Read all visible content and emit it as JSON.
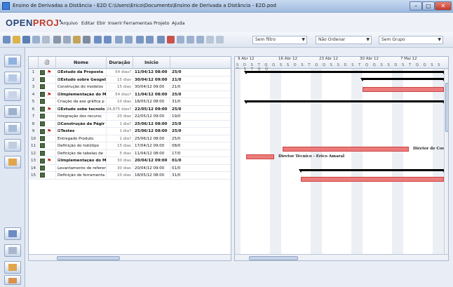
{
  "window": {
    "title": "Ensino de Derivadas a Distância - E2D  C:\\Users\\Erico\\Documents\\Ensino de Derivada a Distância - E2D.pod",
    "min": "–",
    "max": "□",
    "close": "✕"
  },
  "app": {
    "logo_a": "OPEN",
    "logo_b": "PROJ",
    "logo_tm": "'"
  },
  "menu": [
    "Arquivo",
    "Editar",
    "Ebir",
    "Inserir",
    "Ferramentas",
    "Projeto",
    "Ajuda"
  ],
  "toolbar": {
    "filter": "Sem filtro",
    "sort": "Não Ordenar",
    "group": "Sem Grupo"
  },
  "table": {
    "headers": [
      "",
      "",
      "Nome",
      "Duração",
      "Início",
      ""
    ],
    "rows": [
      {
        "num": "1",
        "name": "⊟Estudo da Proposta",
        "dur": "54 dias?",
        "ini": "11/04/12 08:00",
        "fim": "25/0",
        "bold": true,
        "pin": true
      },
      {
        "num": "2",
        "name": "⊟Estudo sobre Geogeb",
        "dur": "15 dias",
        "ini": "30/04/12 09:00",
        "fim": "21/0",
        "bold": true,
        "pin": false
      },
      {
        "num": "3",
        "name": "Construção do modelos",
        "dur": "15 dias",
        "ini": "30/04/12 09:00",
        "fim": "21/0",
        "bold": false,
        "pin": false
      },
      {
        "num": "4",
        "name": "⊟Implementação do Mo",
        "dur": "54 dias?",
        "ini": "11/04/12 08:00",
        "fim": "25/0",
        "bold": true,
        "pin": true
      },
      {
        "num": "5",
        "name": "Criação da ase gráfica p",
        "dur": "10 dias",
        "ini": "18/05/12 08:00",
        "fim": "31/0",
        "bold": false,
        "pin": false
      },
      {
        "num": "6",
        "name": "⊟Estudo sobe tecnolo",
        "dur": "24,875 dias?",
        "ini": "22/05/12 09:00",
        "fim": "25/0",
        "bold": true,
        "pin": true
      },
      {
        "num": "7",
        "name": "Integração dos recursc",
        "dur": "20 dias",
        "ini": "22/05/12 09:00",
        "fim": "19/0",
        "bold": false,
        "pin": false
      },
      {
        "num": "8",
        "name": "⊟Construção da Págir",
        "dur": "1 dia?",
        "ini": "25/06/12 08:00",
        "fim": "25/0",
        "bold": true,
        "pin": false
      },
      {
        "num": "9",
        "name": "⊟Testes",
        "dur": "1 dia?",
        "ini": "25/06/12 08:00",
        "fim": "25/0",
        "bold": true,
        "pin": true
      },
      {
        "num": "10",
        "name": "Entregado Produto",
        "dur": "1 dia?",
        "ini": "25/06/12 08:00",
        "fim": "25/0",
        "bold": false,
        "pin": false
      },
      {
        "num": "11",
        "name": "Definição do hotótipo",
        "dur": "15 dias",
        "ini": "17/04/12 09:00",
        "fim": "08/0",
        "bold": false,
        "pin": false
      },
      {
        "num": "12",
        "name": "Definição de tabelas de",
        "dur": "5 dias",
        "ini": "11/04/12 08:00",
        "fim": "17/0",
        "bold": false,
        "pin": false
      },
      {
        "num": "13",
        "name": "⊟Implementação do Mo",
        "dur": "30 dias",
        "ini": "20/04/12 09:00",
        "fim": "01/0",
        "bold": true,
        "pin": true
      },
      {
        "num": "14",
        "name": "Levantamento de referer",
        "dur": "30 dias",
        "ini": "20/04/12 09:00",
        "fim": "01/0",
        "bold": false,
        "pin": false
      },
      {
        "num": "15",
        "name": "Definição de ferramenta",
        "dur": "10 dias",
        "ini": "18/05/12 08:00",
        "fim": "31/0",
        "bold": false,
        "pin": false
      }
    ]
  },
  "gantt": {
    "weeks": [
      "9 Abr 12",
      "16 Abr 12",
      "23 Abr 12",
      "30 Abr 12",
      "7 Mai 12"
    ],
    "days": "S D S T Q Q S S D S T Q Q S S D S T Q Q S S D S T Q Q S S D S T Q Q",
    "labels": {
      "row11": "Diretor de Con",
      "row12": "Diretor Técnico - Erico Amaral"
    }
  },
  "colors": {
    "bar": "#ec7b7b",
    "summary": "#000000",
    "accent": "#27457a"
  }
}
